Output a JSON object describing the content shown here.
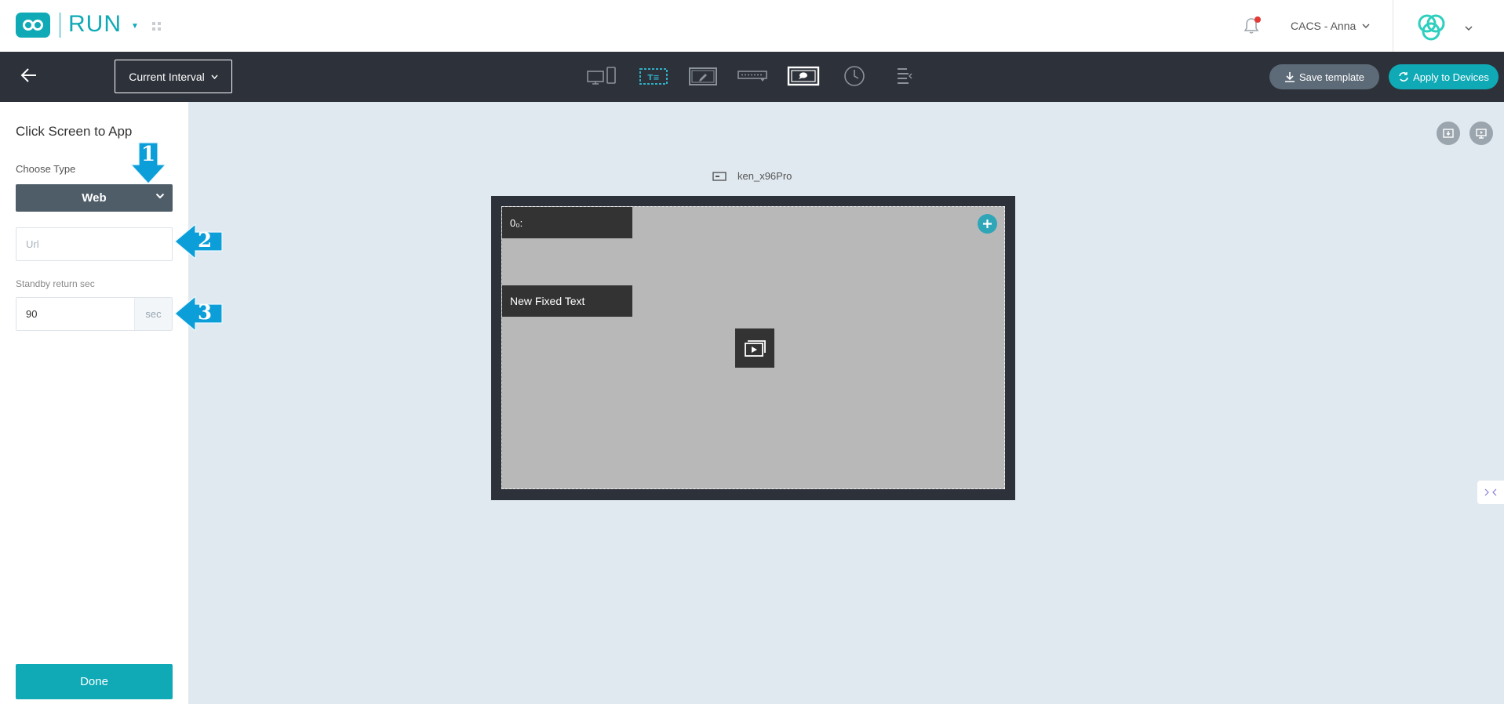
{
  "header": {
    "brand": "RUN",
    "user": "CACS - Anna"
  },
  "toolbar": {
    "interval_label": "Current Interval",
    "tools": [
      "devices-icon",
      "text-zone-icon",
      "edit-zone-icon",
      "ticker-icon",
      "web-zone-icon",
      "clock-icon",
      "layers-icon"
    ],
    "active_tool": "web-zone-icon",
    "save_template": "Save template",
    "apply_devices": "Apply to Devices"
  },
  "sidebar": {
    "title": "Click Screen to App",
    "choose_type_label": "Choose Type",
    "type_value": "Web",
    "url_placeholder": "Url",
    "url_value": "",
    "standby_label": "Standby return sec",
    "standby_value": "90",
    "standby_unit": "sec",
    "done": "Done"
  },
  "annotations": [
    "1",
    "2",
    "3"
  ],
  "canvas": {
    "device_name": "ken_x96Pro",
    "clock_zone_text": "0₀:",
    "fixed_text_zone": "New Fixed Text"
  },
  "colors": {
    "accent": "#0faab6",
    "toolbar_bg": "#2d313a",
    "canvas_bg": "#e1e9f0",
    "annotation_arrow": "#0b9ed9",
    "notification_dot": "#e53935"
  }
}
